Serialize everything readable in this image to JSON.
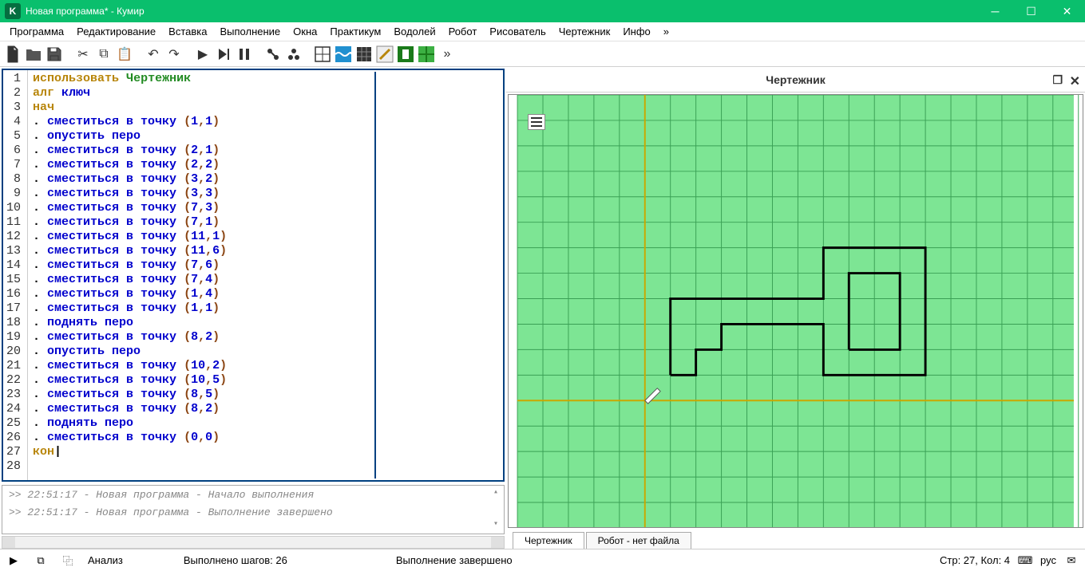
{
  "window": {
    "title": "Новая программа* - Кумир",
    "logo_letter": "K"
  },
  "menu": [
    "Программа",
    "Редактирование",
    "Вставка",
    "Выполнение",
    "Окна",
    "Практикум",
    "Водолей",
    "Робот",
    "Рисователь",
    "Чертежник",
    "Инфо",
    "»"
  ],
  "drawer": {
    "title": "Чертежник",
    "grid_origin": [
      5,
      12
    ],
    "cell": 33,
    "pen_pos": [
      0,
      0
    ],
    "path1": [
      [
        1,
        1
      ],
      [
        2,
        1
      ],
      [
        2,
        2
      ],
      [
        3,
        2
      ],
      [
        3,
        3
      ],
      [
        7,
        3
      ],
      [
        7,
        1
      ],
      [
        11,
        1
      ],
      [
        11,
        6
      ],
      [
        7,
        6
      ],
      [
        7,
        4
      ],
      [
        1,
        4
      ],
      [
        1,
        1
      ]
    ],
    "path2": [
      [
        8,
        2
      ],
      [
        10,
        2
      ],
      [
        10,
        5
      ],
      [
        8,
        5
      ],
      [
        8,
        2
      ]
    ]
  },
  "code": {
    "lines": [
      {
        "n": 1,
        "tokens": [
          [
            "использовать",
            "kw-use"
          ],
          [
            " ",
            ""
          ],
          [
            "Чертежник",
            "kw-ident"
          ]
        ]
      },
      {
        "n": 2,
        "tokens": [
          [
            "алг",
            "kw-struct"
          ],
          [
            " ключ",
            "kw-cmd"
          ]
        ]
      },
      {
        "n": 3,
        "tokens": [
          [
            "нач",
            "kw-struct"
          ]
        ]
      },
      {
        "n": 4,
        "tokens": [
          [
            ". ",
            "kw-dot"
          ],
          [
            "сместиться в точку",
            "kw-cmd"
          ],
          [
            " (",
            "kw-punct"
          ],
          [
            "1",
            "kw-num"
          ],
          [
            ",",
            "kw-punct"
          ],
          [
            "1",
            "kw-num"
          ],
          [
            ")",
            "kw-punct"
          ]
        ]
      },
      {
        "n": 5,
        "tokens": [
          [
            ". ",
            "kw-dot"
          ],
          [
            "опустить перо",
            "kw-cmd"
          ]
        ]
      },
      {
        "n": 6,
        "tokens": [
          [
            ". ",
            "kw-dot"
          ],
          [
            "сместиться в точку",
            "kw-cmd"
          ],
          [
            " (",
            "kw-punct"
          ],
          [
            "2",
            "kw-num"
          ],
          [
            ",",
            "kw-punct"
          ],
          [
            "1",
            "kw-num"
          ],
          [
            ")",
            "kw-punct"
          ]
        ]
      },
      {
        "n": 7,
        "tokens": [
          [
            ". ",
            "kw-dot"
          ],
          [
            "сместиться в точку",
            "kw-cmd"
          ],
          [
            " (",
            "kw-punct"
          ],
          [
            "2",
            "kw-num"
          ],
          [
            ",",
            "kw-punct"
          ],
          [
            "2",
            "kw-num"
          ],
          [
            ")",
            "kw-punct"
          ]
        ]
      },
      {
        "n": 8,
        "tokens": [
          [
            ". ",
            "kw-dot"
          ],
          [
            "сместиться в точку",
            "kw-cmd"
          ],
          [
            " (",
            "kw-punct"
          ],
          [
            "3",
            "kw-num"
          ],
          [
            ",",
            "kw-punct"
          ],
          [
            "2",
            "kw-num"
          ],
          [
            ")",
            "kw-punct"
          ]
        ]
      },
      {
        "n": 9,
        "tokens": [
          [
            ". ",
            "kw-dot"
          ],
          [
            "сместиться в точку",
            "kw-cmd"
          ],
          [
            " (",
            "kw-punct"
          ],
          [
            "3",
            "kw-num"
          ],
          [
            ",",
            "kw-punct"
          ],
          [
            "3",
            "kw-num"
          ],
          [
            ")",
            "kw-punct"
          ]
        ]
      },
      {
        "n": 10,
        "tokens": [
          [
            ". ",
            "kw-dot"
          ],
          [
            "сместиться в точку",
            "kw-cmd"
          ],
          [
            " (",
            "kw-punct"
          ],
          [
            "7",
            "kw-num"
          ],
          [
            ",",
            "kw-punct"
          ],
          [
            "3",
            "kw-num"
          ],
          [
            ")",
            "kw-punct"
          ]
        ]
      },
      {
        "n": 11,
        "tokens": [
          [
            ". ",
            "kw-dot"
          ],
          [
            "сместиться в точку",
            "kw-cmd"
          ],
          [
            " (",
            "kw-punct"
          ],
          [
            "7",
            "kw-num"
          ],
          [
            ",",
            "kw-punct"
          ],
          [
            "1",
            "kw-num"
          ],
          [
            ")",
            "kw-punct"
          ]
        ]
      },
      {
        "n": 12,
        "tokens": [
          [
            ". ",
            "kw-dot"
          ],
          [
            "сместиться в точку",
            "kw-cmd"
          ],
          [
            " (",
            "kw-punct"
          ],
          [
            "11",
            "kw-num"
          ],
          [
            ",",
            "kw-punct"
          ],
          [
            "1",
            "kw-num"
          ],
          [
            ")",
            "kw-punct"
          ]
        ]
      },
      {
        "n": 13,
        "tokens": [
          [
            ". ",
            "kw-dot"
          ],
          [
            "сместиться в точку",
            "kw-cmd"
          ],
          [
            " (",
            "kw-punct"
          ],
          [
            "11",
            "kw-num"
          ],
          [
            ",",
            "kw-punct"
          ],
          [
            "6",
            "kw-num"
          ],
          [
            ")",
            "kw-punct"
          ]
        ]
      },
      {
        "n": 14,
        "tokens": [
          [
            ". ",
            "kw-dot"
          ],
          [
            "сместиться в точку",
            "kw-cmd"
          ],
          [
            " (",
            "kw-punct"
          ],
          [
            "7",
            "kw-num"
          ],
          [
            ",",
            "kw-punct"
          ],
          [
            "6",
            "kw-num"
          ],
          [
            ")",
            "kw-punct"
          ]
        ]
      },
      {
        "n": 15,
        "tokens": [
          [
            ". ",
            "kw-dot"
          ],
          [
            "сместиться в точку",
            "kw-cmd"
          ],
          [
            " (",
            "kw-punct"
          ],
          [
            "7",
            "kw-num"
          ],
          [
            ",",
            "kw-punct"
          ],
          [
            "4",
            "kw-num"
          ],
          [
            ")",
            "kw-punct"
          ]
        ]
      },
      {
        "n": 16,
        "tokens": [
          [
            ". ",
            "kw-dot"
          ],
          [
            "сместиться в точку",
            "kw-cmd"
          ],
          [
            " (",
            "kw-punct"
          ],
          [
            "1",
            "kw-num"
          ],
          [
            ",",
            "kw-punct"
          ],
          [
            "4",
            "kw-num"
          ],
          [
            ")",
            "kw-punct"
          ]
        ]
      },
      {
        "n": 17,
        "tokens": [
          [
            ". ",
            "kw-dot"
          ],
          [
            "сместиться в точку",
            "kw-cmd"
          ],
          [
            " (",
            "kw-punct"
          ],
          [
            "1",
            "kw-num"
          ],
          [
            ",",
            "kw-punct"
          ],
          [
            "1",
            "kw-num"
          ],
          [
            ")",
            "kw-punct"
          ]
        ]
      },
      {
        "n": 18,
        "tokens": [
          [
            ". ",
            "kw-dot"
          ],
          [
            "поднять перо",
            "kw-cmd"
          ]
        ]
      },
      {
        "n": 19,
        "tokens": [
          [
            ". ",
            "kw-dot"
          ],
          [
            "сместиться в точку",
            "kw-cmd"
          ],
          [
            " (",
            "kw-punct"
          ],
          [
            "8",
            "kw-num"
          ],
          [
            ",",
            "kw-punct"
          ],
          [
            "2",
            "kw-num"
          ],
          [
            ")",
            "kw-punct"
          ]
        ]
      },
      {
        "n": 20,
        "tokens": [
          [
            ". ",
            "kw-dot"
          ],
          [
            "опустить перо",
            "kw-cmd"
          ]
        ]
      },
      {
        "n": 21,
        "tokens": [
          [
            ". ",
            "kw-dot"
          ],
          [
            "сместиться в точку",
            "kw-cmd"
          ],
          [
            " (",
            "kw-punct"
          ],
          [
            "10",
            "kw-num"
          ],
          [
            ",",
            "kw-punct"
          ],
          [
            "2",
            "kw-num"
          ],
          [
            ")",
            "kw-punct"
          ]
        ]
      },
      {
        "n": 22,
        "tokens": [
          [
            ". ",
            "kw-dot"
          ],
          [
            "сместиться в точку",
            "kw-cmd"
          ],
          [
            " (",
            "kw-punct"
          ],
          [
            "10",
            "kw-num"
          ],
          [
            ",",
            "kw-punct"
          ],
          [
            "5",
            "kw-num"
          ],
          [
            ")",
            "kw-punct"
          ]
        ]
      },
      {
        "n": 23,
        "tokens": [
          [
            ". ",
            "kw-dot"
          ],
          [
            "сместиться в точку",
            "kw-cmd"
          ],
          [
            " (",
            "kw-punct"
          ],
          [
            "8",
            "kw-num"
          ],
          [
            ",",
            "kw-punct"
          ],
          [
            "5",
            "kw-num"
          ],
          [
            ")",
            "kw-punct"
          ]
        ]
      },
      {
        "n": 24,
        "tokens": [
          [
            ". ",
            "kw-dot"
          ],
          [
            "сместиться в точку",
            "kw-cmd"
          ],
          [
            " (",
            "kw-punct"
          ],
          [
            "8",
            "kw-num"
          ],
          [
            ",",
            "kw-punct"
          ],
          [
            "2",
            "kw-num"
          ],
          [
            ")",
            "kw-punct"
          ]
        ]
      },
      {
        "n": 25,
        "tokens": [
          [
            ". ",
            "kw-dot"
          ],
          [
            "поднять перо",
            "kw-cmd"
          ]
        ]
      },
      {
        "n": 26,
        "tokens": [
          [
            ". ",
            "kw-dot"
          ],
          [
            "сместиться в точку",
            "kw-cmd"
          ],
          [
            " (",
            "kw-punct"
          ],
          [
            "0",
            "kw-num"
          ],
          [
            ",",
            "kw-punct"
          ],
          [
            "0",
            "kw-num"
          ],
          [
            ")",
            "kw-punct"
          ]
        ]
      },
      {
        "n": 27,
        "tokens": [
          [
            "кон",
            "kw-struct"
          ],
          [
            "|",
            ""
          ]
        ]
      },
      {
        "n": 28,
        "tokens": []
      }
    ]
  },
  "console": [
    ">> 22:51:17 - Новая программа - Начало выполнения",
    ">> 22:51:17 - Новая программа - Выполнение завершено"
  ],
  "tabs": [
    {
      "label": "Чертежник",
      "active": true
    },
    {
      "label": "Робот - нет файла",
      "active": false
    }
  ],
  "status": {
    "analyze": "Анализ",
    "steps": "Выполнено шагов: 26",
    "done": "Выполнение завершено",
    "pos": "Стр: 27, Кол: 4",
    "lang": "рус"
  }
}
